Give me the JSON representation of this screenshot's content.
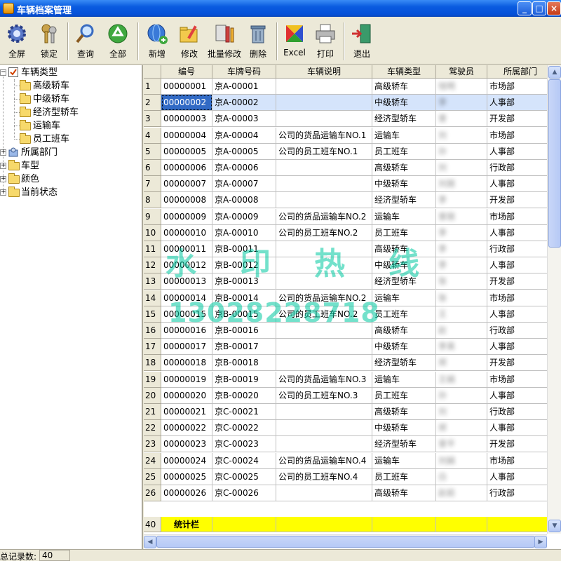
{
  "window": {
    "title": "车辆档案管理",
    "minimize": "_",
    "maximize": "□",
    "close": "×"
  },
  "toolbar": {
    "fullscreen": "全屏",
    "lock": "锁定",
    "query": "查询",
    "all": "全部",
    "add": "新增",
    "edit": "修改",
    "batch_edit": "批量修改",
    "delete": "删除",
    "excel": "Excel",
    "print": "打印",
    "exit": "退出"
  },
  "tree": {
    "root": "车辆类型",
    "children": [
      "高级轿车",
      "中级轿车",
      "经济型轿车",
      "运输车",
      "员工班车"
    ],
    "others": [
      "所属部门",
      "车型",
      "颜色",
      "当前状态"
    ]
  },
  "grid": {
    "columns": [
      "编号",
      "车牌号码",
      "车辆说明",
      "车辆类型",
      "驾驶员",
      "所属部门"
    ],
    "rows": [
      {
        "n": "1",
        "id": "00000001",
        "plate": "京A-00001",
        "desc": "",
        "type": "高级轿车",
        "driver": "钱明",
        "dept": "市场部"
      },
      {
        "n": "2",
        "id": "00000002",
        "plate": "京A-00002",
        "desc": "",
        "type": "中级轿车",
        "driver": "李",
        "dept": "人事部"
      },
      {
        "n": "3",
        "id": "00000003",
        "plate": "京A-00003",
        "desc": "",
        "type": "经济型轿车",
        "driver": "曾",
        "dept": "开发部"
      },
      {
        "n": "4",
        "id": "00000004",
        "plate": "京A-00004",
        "desc": "公司的货品运输车NO.1",
        "type": "运输车",
        "driver": "刘",
        "dept": "市场部"
      },
      {
        "n": "5",
        "id": "00000005",
        "plate": "京A-00005",
        "desc": "公司的员工班车NO.1",
        "type": "员工班车",
        "driver": "孙",
        "dept": "人事部"
      },
      {
        "n": "6",
        "id": "00000006",
        "plate": "京A-00006",
        "desc": "",
        "type": "高级轿车",
        "driver": "刘",
        "dept": "行政部"
      },
      {
        "n": "7",
        "id": "00000007",
        "plate": "京A-00007",
        "desc": "",
        "type": "中级轿车",
        "driver": "刘丽",
        "dept": "人事部"
      },
      {
        "n": "8",
        "id": "00000008",
        "plate": "京A-00008",
        "desc": "",
        "type": "经济型轿车",
        "driver": "李",
        "dept": "开发部"
      },
      {
        "n": "9",
        "id": "00000009",
        "plate": "京A-00009",
        "desc": "公司的货品运输车NO.2",
        "type": "运输车",
        "driver": "曾丽",
        "dept": "市场部"
      },
      {
        "n": "10",
        "id": "00000010",
        "plate": "京A-00010",
        "desc": "公司的员工班车NO.2",
        "type": "员工班车",
        "driver": "李",
        "dept": "人事部"
      },
      {
        "n": "11",
        "id": "00000011",
        "plate": "京B-00011",
        "desc": "",
        "type": "高级轿车",
        "driver": "李",
        "dept": "行政部"
      },
      {
        "n": "12",
        "id": "00000012",
        "plate": "京B-00012",
        "desc": "",
        "type": "中级轿车",
        "driver": "李",
        "dept": "人事部"
      },
      {
        "n": "13",
        "id": "00000013",
        "plate": "京B-00013",
        "desc": "",
        "type": "经济型轿车",
        "driver": "张",
        "dept": "开发部"
      },
      {
        "n": "14",
        "id": "00000014",
        "plate": "京B-00014",
        "desc": "公司的货品运输车NO.2",
        "type": "运输车",
        "driver": "张",
        "dept": "市场部"
      },
      {
        "n": "15",
        "id": "00000015",
        "plate": "京B-00015",
        "desc": "公司的员工班车NO.2",
        "type": "员工班车",
        "driver": "王",
        "dept": "人事部"
      },
      {
        "n": "16",
        "id": "00000016",
        "plate": "京B-00016",
        "desc": "",
        "type": "高级轿车",
        "driver": "赵",
        "dept": "行政部"
      },
      {
        "n": "17",
        "id": "00000017",
        "plate": "京B-00017",
        "desc": "",
        "type": "中级轿车",
        "driver": "李英",
        "dept": "人事部"
      },
      {
        "n": "18",
        "id": "00000018",
        "plate": "京B-00018",
        "desc": "",
        "type": "经济型轿车",
        "driver": "郑",
        "dept": "开发部"
      },
      {
        "n": "19",
        "id": "00000019",
        "plate": "京B-00019",
        "desc": "公司的货品运输车NO.3",
        "type": "运输车",
        "driver": "王娟",
        "dept": "市场部"
      },
      {
        "n": "20",
        "id": "00000020",
        "plate": "京B-00020",
        "desc": "公司的员工班车NO.3",
        "type": "员工班车",
        "driver": "孙",
        "dept": "人事部"
      },
      {
        "n": "21",
        "id": "00000021",
        "plate": "京C-00021",
        "desc": "",
        "type": "高级轿车",
        "driver": "刘",
        "dept": "行政部"
      },
      {
        "n": "22",
        "id": "00000022",
        "plate": "京C-00022",
        "desc": "",
        "type": "中级轿车",
        "driver": "郑",
        "dept": "人事部"
      },
      {
        "n": "23",
        "id": "00000023",
        "plate": "京C-00023",
        "desc": "",
        "type": "经济型轿车",
        "driver": "曾平",
        "dept": "开发部"
      },
      {
        "n": "24",
        "id": "00000024",
        "plate": "京C-00024",
        "desc": "公司的货品运输车NO.4",
        "type": "运输车",
        "driver": "刘娟",
        "dept": "市场部"
      },
      {
        "n": "25",
        "id": "00000025",
        "plate": "京C-00025",
        "desc": "公司的员工班车NO.4",
        "type": "员工班车",
        "driver": "白",
        "dept": "人事部"
      },
      {
        "n": "26",
        "id": "00000026",
        "plate": "京C-00026",
        "desc": "",
        "type": "高级轿车",
        "driver": "赵前",
        "dept": "行政部"
      }
    ],
    "selected_row": 2,
    "stat_row": {
      "n": "40",
      "label": "统计栏"
    }
  },
  "status": {
    "label": "总记录数:",
    "value": "40"
  },
  "watermark": {
    "line1": "水印热线",
    "line2": "13028228718"
  },
  "colors": {
    "titlebar": "#0550d8",
    "selection": "#316ac5",
    "stat_row": "#ffff00",
    "watermark": "#00c8a0"
  }
}
